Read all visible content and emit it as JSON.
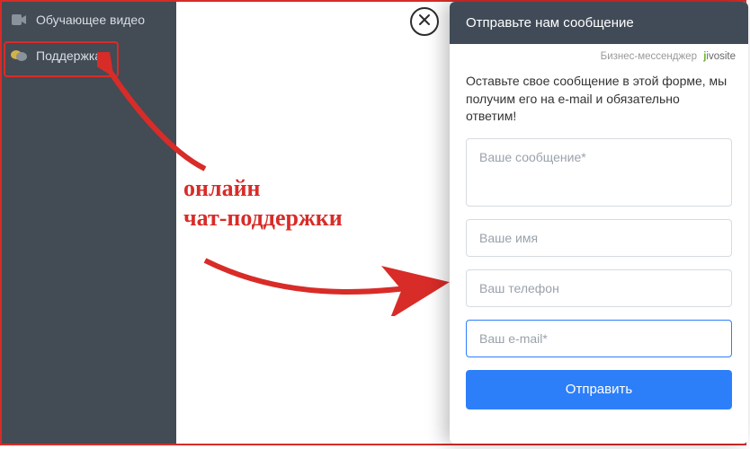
{
  "sidebar": {
    "items": [
      {
        "label": "Обучающее видео",
        "icon": "video-icon"
      },
      {
        "label": "Поддержка",
        "icon": "chat-bubbles-icon"
      }
    ]
  },
  "modal": {
    "close_icon": "close-icon"
  },
  "chat": {
    "header_title": "Отправьте нам сообщение",
    "powered_prefix": "Бизнес-мессенджер",
    "powered_brand_j": "j",
    "powered_brand_rest": "ivosite",
    "instruction": "Оставьте свое сообщение в этой форме, мы получим его на e-mail и обязательно ответим!",
    "fields": {
      "message_placeholder": "Ваше сообщение*",
      "name_placeholder": "Ваше имя",
      "phone_placeholder": "Ваш телефон",
      "email_placeholder": "Ваш e-mail*"
    },
    "submit_label": "Отправить"
  },
  "annotation": {
    "line1": "онлайн",
    "line2": "чат-поддержки"
  },
  "accent_color": "#d82c28",
  "primary_color": "#2d7ff9"
}
